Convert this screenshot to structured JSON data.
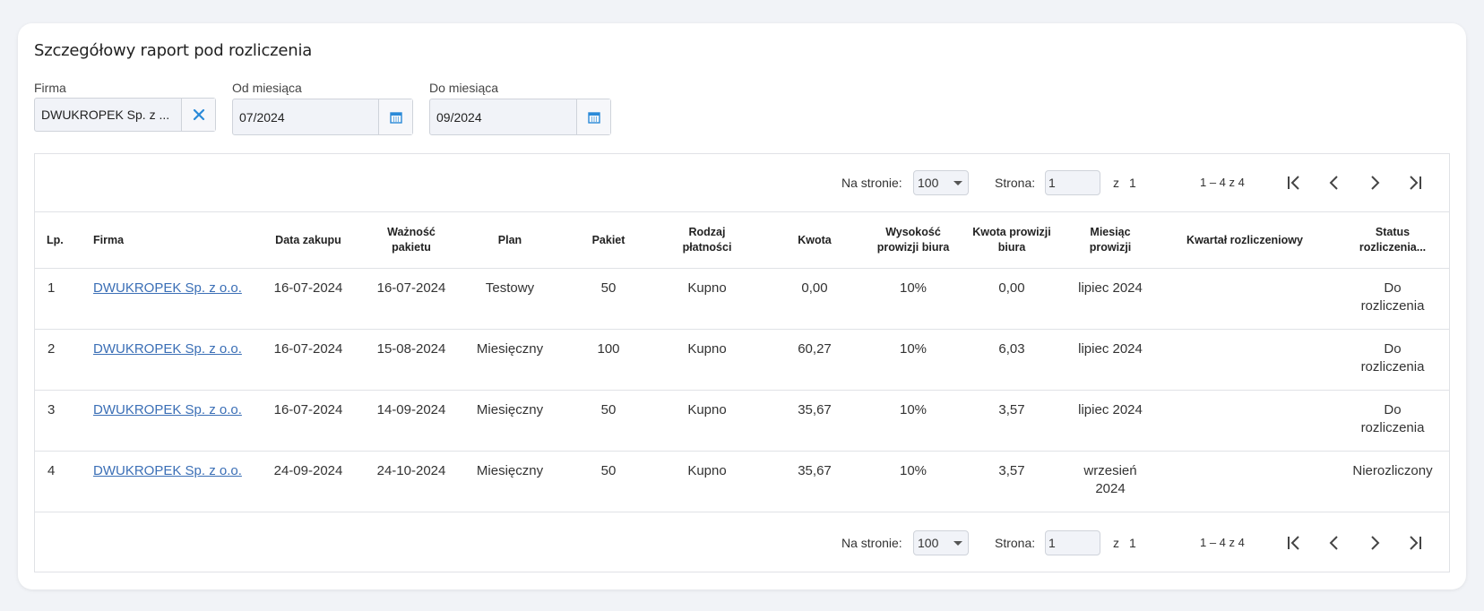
{
  "title": "Szczegółowy raport pod rozliczenia",
  "filters": {
    "company_label": "Firma",
    "company_value": "DWUKROPEK Sp. z ...",
    "from_label": "Od miesiąca",
    "from_value": "07/2024",
    "to_label": "Do miesiąca",
    "to_value": "09/2024"
  },
  "pager": {
    "per_page_label": "Na stronie:",
    "per_page_value": "100",
    "page_label": "Strona:",
    "page_value": "1",
    "of_label": "z",
    "total_pages": "1",
    "range": "1 – 4 z 4"
  },
  "columns": {
    "lp": "Lp.",
    "firma": "Firma",
    "data_zakupu": "Data zakupu",
    "waznosc_1": "Ważność",
    "waznosc_2": "pakietu",
    "plan": "Plan",
    "pakiet": "Pakiet",
    "rodzaj_1": "Rodzaj",
    "rodzaj_2": "płatności",
    "kwota": "Kwota",
    "wysokosc_1": "Wysokość",
    "wysokosc_2": "prowizji biura",
    "kwota_prow_1": "Kwota prowizji",
    "kwota_prow_2": "biura",
    "miesiac_1": "Miesiąc",
    "miesiac_2": "prowizji",
    "kwartal": "Kwartał rozliczeniowy",
    "status_1": "Status",
    "status_2": "rozliczenia..."
  },
  "rows": [
    {
      "lp": "1",
      "firma": "DWUKROPEK Sp. z o.o.",
      "data": "16-07-2024",
      "waznosc": "16-07-2024",
      "plan": "Testowy",
      "pakiet": "50",
      "rodzaj": "Kupno",
      "kwota": "0,00",
      "wysokosc": "10%",
      "kwota_prow": "0,00",
      "miesiac_1": "lipiec 2024",
      "miesiac_2": "",
      "kwartal": "",
      "status_1": "Do",
      "status_2": "rozliczenia"
    },
    {
      "lp": "2",
      "firma": "DWUKROPEK Sp. z o.o.",
      "data": "16-07-2024",
      "waznosc": "15-08-2024",
      "plan": "Miesięczny",
      "pakiet": "100",
      "rodzaj": "Kupno",
      "kwota": "60,27",
      "wysokosc": "10%",
      "kwota_prow": "6,03",
      "miesiac_1": "lipiec 2024",
      "miesiac_2": "",
      "kwartal": "",
      "status_1": "Do",
      "status_2": "rozliczenia"
    },
    {
      "lp": "3",
      "firma": "DWUKROPEK Sp. z o.o.",
      "data": "16-07-2024",
      "waznosc": "14-09-2024",
      "plan": "Miesięczny",
      "pakiet": "50",
      "rodzaj": "Kupno",
      "kwota": "35,67",
      "wysokosc": "10%",
      "kwota_prow": "3,57",
      "miesiac_1": "lipiec 2024",
      "miesiac_2": "",
      "kwartal": "",
      "status_1": "Do",
      "status_2": "rozliczenia"
    },
    {
      "lp": "4",
      "firma": "DWUKROPEK Sp. z o.o.",
      "data": "24-09-2024",
      "waznosc": "24-10-2024",
      "plan": "Miesięczny",
      "pakiet": "50",
      "rodzaj": "Kupno",
      "kwota": "35,67",
      "wysokosc": "10%",
      "kwota_prow": "3,57",
      "miesiac_1": "wrzesień",
      "miesiac_2": "2024",
      "kwartal": "",
      "status_1": "Nierozliczony",
      "status_2": ""
    }
  ]
}
